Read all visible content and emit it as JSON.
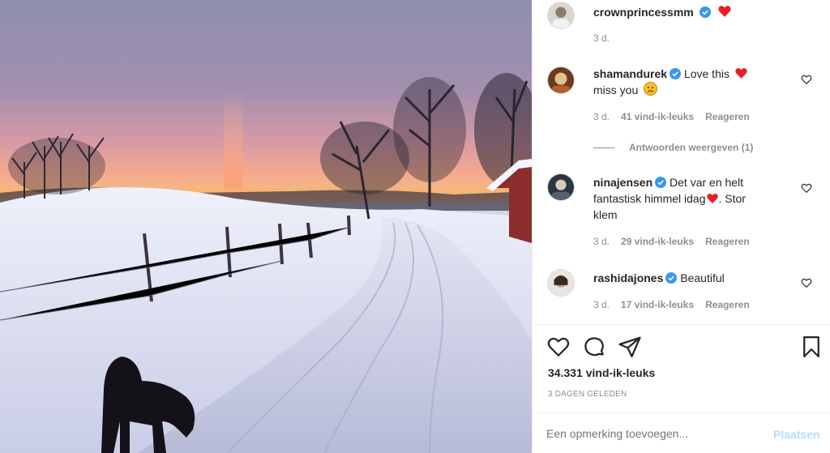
{
  "post": {
    "author": "crownprincessmm",
    "author_time": "3 d."
  },
  "comments": [
    {
      "user": "shamandurek",
      "text": "Love this",
      "text2": "miss you",
      "time": "3 d.",
      "likes": "41 vind-ik-leuks",
      "reply": "Reageren",
      "view_replies": "Antwoorden weergeven (1)"
    },
    {
      "user": "ninajensen",
      "text": "Det var en helt",
      "text2": "fantastisk himmel idag",
      "text2b": ". Stor",
      "text3": "klem",
      "time": "3 d.",
      "likes": "29 vind-ik-leuks",
      "reply": "Reageren"
    },
    {
      "user": "rashidajones",
      "text": "Beautiful",
      "time": "3 d.",
      "likes": "17 vind-ik-leuks",
      "reply": "Reageren"
    }
  ],
  "footer": {
    "likes_count": "34.331 vind-ik-leuks",
    "timestamp": "3 DAGEN GELEDEN",
    "comment_placeholder": "Een opmerking toevoegen...",
    "post_button": "Plaatsen"
  },
  "colors": {
    "verified": "#3897f0",
    "heart_red": "#ed4956",
    "post_button_disabled": "#b2dffc",
    "meta_gray": "#8e8e8e"
  },
  "icons": [
    "heart-icon",
    "comment-icon",
    "share-icon",
    "bookmark-icon",
    "verified-icon",
    "comment-like-icon"
  ]
}
